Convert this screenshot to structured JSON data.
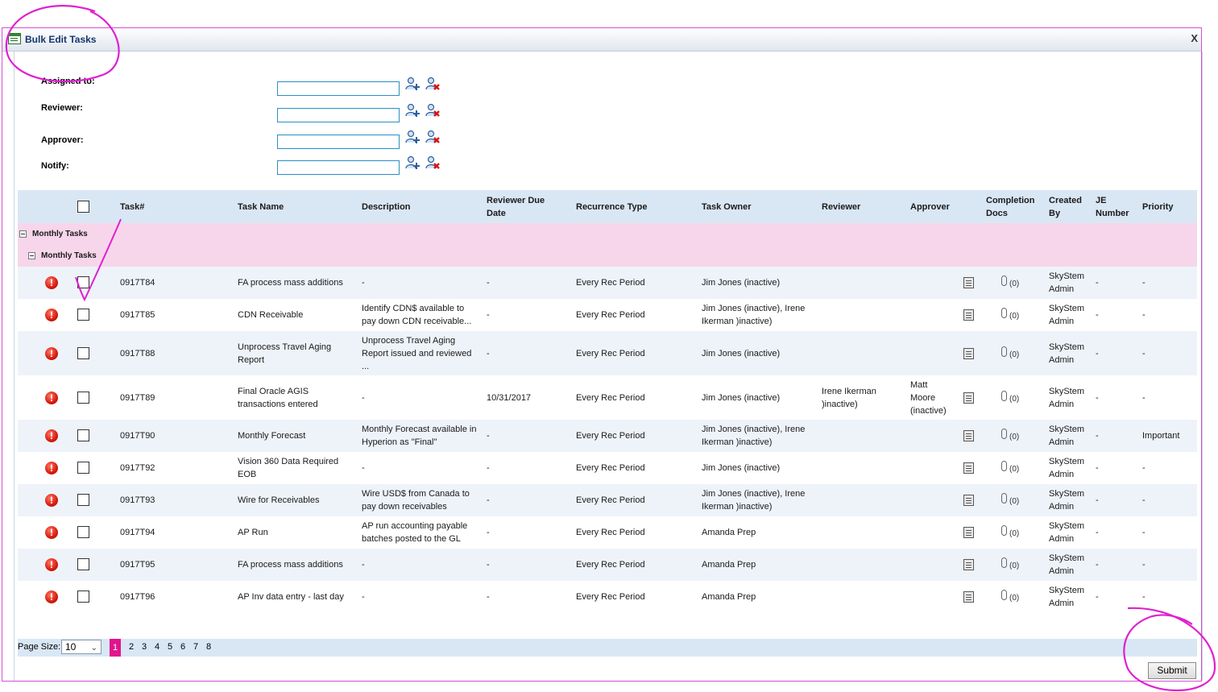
{
  "dialog": {
    "title": "Bulk Edit Tasks",
    "close_label": "X"
  },
  "form": {
    "fields": [
      {
        "label": "Assigned to:",
        "value": ""
      },
      {
        "label": "Reviewer:",
        "value": ""
      },
      {
        "label": "Approver:",
        "value": ""
      },
      {
        "label": "Notify:",
        "value": ""
      }
    ]
  },
  "grid": {
    "headers": {
      "task_no": "Task#",
      "task_name": "Task Name",
      "description": "Description",
      "reviewer_due_1": "Reviewer Due",
      "reviewer_due_2": "Date",
      "recurrence": "Recurrence Type",
      "task_owner": "Task Owner",
      "reviewer": "Reviewer",
      "approver": "Approver",
      "completion_1": "Completion",
      "completion_2": "Docs",
      "created_1": "Created",
      "created_2": "By",
      "je_1": "JE",
      "je_2": "Number",
      "priority": "Priority"
    },
    "group_outer": "Monthly Tasks",
    "group_inner": "Monthly Tasks",
    "rows": [
      {
        "task_no": "0917T84",
        "name": [
          "FA process mass additions"
        ],
        "desc": [
          "-"
        ],
        "due": "-",
        "recurrence": "Every Rec Period",
        "owner": [
          "Jim Jones (inactive)"
        ],
        "reviewer": [],
        "approver": [],
        "clip": "(0)",
        "created": [
          "SkyStem",
          "Admin"
        ],
        "je": "-",
        "priority": "-"
      },
      {
        "task_no": "0917T85",
        "name": [
          "CDN Receivable"
        ],
        "desc": [
          "Identify CDN$ available to",
          "pay down CDN receivable..."
        ],
        "due": "-",
        "recurrence": "Every Rec Period",
        "owner": [
          "Jim Jones (inactive), Irene",
          "Ikerman )inactive)"
        ],
        "reviewer": [],
        "approver": [],
        "clip": "(0)",
        "created": [
          "SkyStem",
          "Admin"
        ],
        "je": "-",
        "priority": "-"
      },
      {
        "task_no": "0917T88",
        "name": [
          "Unprocess Travel Aging",
          "Report"
        ],
        "desc": [
          "Unprocess Travel Aging",
          "Report issued and reviewed",
          "..."
        ],
        "due": "-",
        "recurrence": "Every Rec Period",
        "owner": [
          "Jim Jones (inactive)"
        ],
        "reviewer": [],
        "approver": [],
        "clip": "(0)",
        "created": [
          "SkyStem",
          "Admin"
        ],
        "je": "-",
        "priority": "-"
      },
      {
        "task_no": "0917T89",
        "name": [
          "Final Oracle AGIS",
          "transactions entered"
        ],
        "desc": [
          "-"
        ],
        "due": "10/31/2017",
        "recurrence": "Every Rec Period",
        "owner": [
          "Jim Jones (inactive)"
        ],
        "reviewer": [
          "Irene Ikerman",
          ")inactive)"
        ],
        "approver": [
          "Matt",
          "Moore",
          "(inactive)"
        ],
        "clip": "(0)",
        "created": [
          "SkyStem",
          "Admin"
        ],
        "je": "-",
        "priority": "-"
      },
      {
        "task_no": "0917T90",
        "name": [
          "Monthly Forecast"
        ],
        "desc": [
          "Monthly Forecast available in",
          "Hyperion as \"Final\""
        ],
        "due": "-",
        "recurrence": "Every Rec Period",
        "owner": [
          "Jim Jones (inactive), Irene",
          "Ikerman )inactive)"
        ],
        "reviewer": [],
        "approver": [],
        "clip": "(0)",
        "created": [
          "SkyStem",
          "Admin"
        ],
        "je": "-",
        "priority": "Important"
      },
      {
        "task_no": "0917T92",
        "name": [
          "Vision 360 Data Required",
          "EOB"
        ],
        "desc": [
          "-"
        ],
        "due": "-",
        "recurrence": "Every Rec Period",
        "owner": [
          "Jim Jones (inactive)"
        ],
        "reviewer": [],
        "approver": [],
        "clip": "(0)",
        "created": [
          "SkyStem",
          "Admin"
        ],
        "je": "-",
        "priority": "-"
      },
      {
        "task_no": "0917T93",
        "name": [
          "Wire for Receivables"
        ],
        "desc": [
          "Wire USD$ from Canada to",
          "pay down receivables"
        ],
        "due": "-",
        "recurrence": "Every Rec Period",
        "owner": [
          "Jim Jones (inactive), Irene",
          "Ikerman )inactive)"
        ],
        "reviewer": [],
        "approver": [],
        "clip": "(0)",
        "created": [
          "SkyStem",
          "Admin"
        ],
        "je": "-",
        "priority": "-"
      },
      {
        "task_no": "0917T94",
        "name": [
          "AP Run"
        ],
        "desc": [
          "AP run accounting payable",
          "batches posted to the GL"
        ],
        "due": "-",
        "recurrence": "Every Rec Period",
        "owner": [
          "Amanda Prep"
        ],
        "reviewer": [],
        "approver": [],
        "clip": "(0)",
        "created": [
          "SkyStem",
          "Admin"
        ],
        "je": "-",
        "priority": "-"
      },
      {
        "task_no": "0917T95",
        "name": [
          "FA process mass additions"
        ],
        "desc": [
          "-"
        ],
        "due": "-",
        "recurrence": "Every Rec Period",
        "owner": [
          "Amanda Prep"
        ],
        "reviewer": [],
        "approver": [],
        "clip": "(0)",
        "created": [
          "SkyStem",
          "Admin"
        ],
        "je": "-",
        "priority": "-"
      },
      {
        "task_no": "0917T96",
        "name": [
          "AP Inv data entry - last day"
        ],
        "desc": [
          "-"
        ],
        "due": "-",
        "recurrence": "Every Rec Period",
        "owner": [
          "Amanda Prep"
        ],
        "reviewer": [],
        "approver": [],
        "clip": "(0)",
        "created": [
          "SkyStem",
          "Admin"
        ],
        "je": "-",
        "priority": "-"
      }
    ]
  },
  "pager": {
    "label": "Page Size:",
    "page_size": "10",
    "pages": [
      "1",
      "2",
      "3",
      "4",
      "5",
      "6",
      "7",
      "8"
    ],
    "current": "1"
  },
  "actions": {
    "submit_label": "Submit"
  },
  "colors": {
    "header_bg": "#d9e7f5",
    "group_bg": "#f7d6eb",
    "active_page": "#e0158b",
    "annotation": "#e020d0"
  }
}
